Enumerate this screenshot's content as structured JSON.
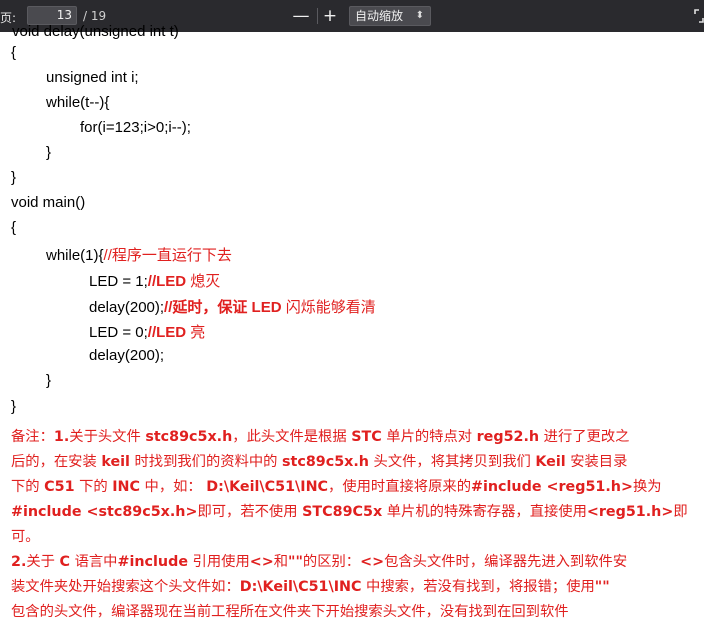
{
  "toolbar": {
    "page_label": "页:",
    "page_current": "13",
    "page_total": "/ 19",
    "zoom_out": "—",
    "zoom_in": "+",
    "zoom_value": "自动缩放",
    "zoom_arrow": "⬍"
  },
  "code": {
    "top_partial": "void delay(unsigned int t)",
    "l1": "{",
    "l2": "unsigned int i;",
    "l3": "while(t--){",
    "l4": "for(i=123;i>0;i--);",
    "l5": "}",
    "l6": "}",
    "l7": "void main()",
    "l8": "{",
    "l9_code": "while(1){",
    "l9_comment": "//程序一直运行下去",
    "l10_code": "LED = 1;",
    "l10_cm_a": "//LED",
    "l10_cm_b": " 熄灭",
    "l11_code": "delay(200);",
    "l11_cm_a": "//延时，保证",
    "l11_cm_b": " LED ",
    "l11_cm_c": "闪烁能够看清",
    "l12_code": "LED = 0;",
    "l12_cm_a": "//LED",
    "l12_cm_b": " 亮",
    "l13": "delay(200);",
    "l14": "}",
    "l15": "}"
  },
  "note": {
    "n1_a": "备注：",
    "n1_b": "1.",
    "n1_c": "关于头文件 ",
    "n1_d": "stc89c5x.h",
    "n1_e": "，此头文件是根据 ",
    "n1_f": "STC",
    "n1_g": " 单片的特点对 ",
    "n1_h": "reg52.h",
    "n1_i": " 进行了更改之",
    "n2_a": "后的，在安装 ",
    "n2_b": "keil",
    "n2_c": " 时找到我们的资料中的 ",
    "n2_d": "stc89c5x.h",
    "n2_e": " 头文件，将其拷贝到我们 ",
    "n2_f": "Keil",
    "n2_g": " 安装目录",
    "n3_a": "下的 ",
    "n3_b": "C51",
    "n3_c": " 下的 ",
    "n3_d": "INC",
    "n3_e": " 中，如：  ",
    "n3_f": "D:\\Keil\\C51\\INC",
    "n3_g": "，使用时直接将原来的",
    "n3_h": "#include  <reg51.h>",
    "n3_i": "换为",
    "n4_a": "#include <stc89c5x.h>",
    "n4_b": "即可，若不使用 ",
    "n4_c": "STC89C5x",
    "n4_d": " 单片机的特殊寄存器，直接使用",
    "n4_e": "<reg51.h>",
    "n4_f": "即",
    "n5": "可。",
    "n6_a": "2.",
    "n6_b": "关于 ",
    "n6_c": "C",
    "n6_d": " 语言中",
    "n6_e": "#include",
    "n6_f": " 引用使用",
    "n6_g": "<>",
    "n6_h": "和",
    "n6_i": "\"\"",
    "n6_j": "的区别：",
    "n6_k": "<>",
    "n6_l": "包含头文件时，编译器先进入到软件安",
    "n7_a": "装文件夹处开始搜索这个头文件如：",
    "n7_b": "D:\\Keil\\C51\\INC",
    "n7_c": " 中搜索，若没有找到，将报错；使用",
    "n7_d": "\"\"",
    "n8": "包含的头文件，编译器现在当前工程所在文件夹下开始搜索头文件，没有找到在回到软件"
  }
}
